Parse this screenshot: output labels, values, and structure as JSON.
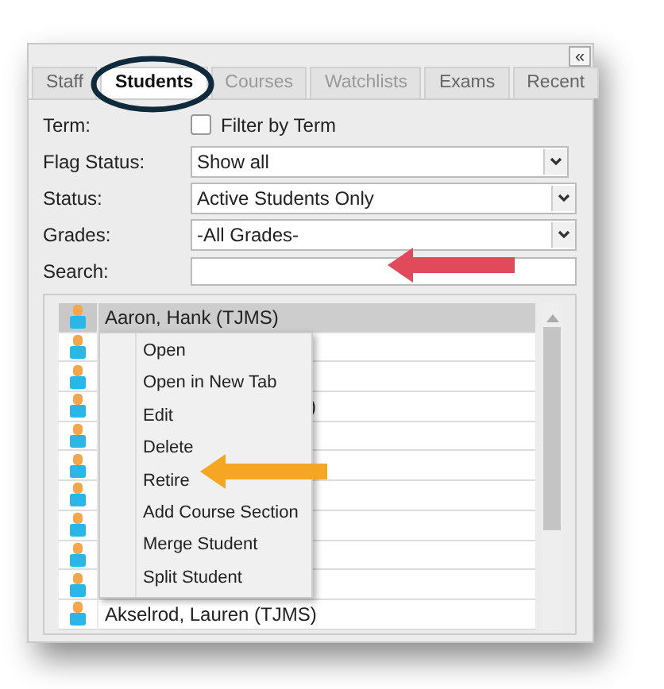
{
  "collapse_button": "«",
  "tabs": [
    {
      "label": "Staff",
      "selected": false,
      "disabled": false
    },
    {
      "label": "Students",
      "selected": true,
      "disabled": false
    },
    {
      "label": "Courses",
      "selected": false,
      "disabled": true
    },
    {
      "label": "Watchlists",
      "selected": false,
      "disabled": true
    },
    {
      "label": "Exams",
      "selected": false,
      "disabled": false
    },
    {
      "label": "Recent",
      "selected": false,
      "disabled": false
    }
  ],
  "filters": [
    {
      "kind": "checkbox",
      "label": "Term:",
      "text": "Filter by Term",
      "checked": false
    },
    {
      "kind": "select",
      "label": "Flag Status:",
      "value": "Show all"
    },
    {
      "kind": "select",
      "label": "Status:",
      "value": "Active Students Only"
    },
    {
      "kind": "select",
      "label": "Grades:",
      "value": "-All Grades-"
    },
    {
      "kind": "search",
      "label": "Search:"
    }
  ],
  "students": [
    {
      "kind": "full",
      "name": "Aaron, Hank (TJMS)",
      "selected": true
    },
    {
      "kind": "covered",
      "selected": false
    },
    {
      "kind": "covered",
      "selected": false
    },
    {
      "kind": "fragment",
      "name": ")",
      "selected": false
    },
    {
      "kind": "covered",
      "selected": false
    },
    {
      "kind": "covered",
      "selected": false
    },
    {
      "kind": "covered",
      "selected": false
    },
    {
      "kind": "covered",
      "selected": false
    },
    {
      "kind": "covered",
      "selected": false
    },
    {
      "kind": "covered",
      "selected": false
    },
    {
      "kind": "full",
      "name": "Akselrod, Lauren (TJMS)",
      "selected": false
    }
  ],
  "context_menu": [
    "Open",
    "Open in New Tab",
    "Edit",
    "Delete",
    "Retire",
    "Add Course Section",
    "Merge Student",
    "Split Student"
  ],
  "annotations": [
    {
      "kind": "ellipse",
      "color": "#0f2a3a"
    },
    {
      "kind": "arrow",
      "color": "#e04a5a"
    },
    {
      "kind": "arrow",
      "color": "#f5a623"
    }
  ]
}
